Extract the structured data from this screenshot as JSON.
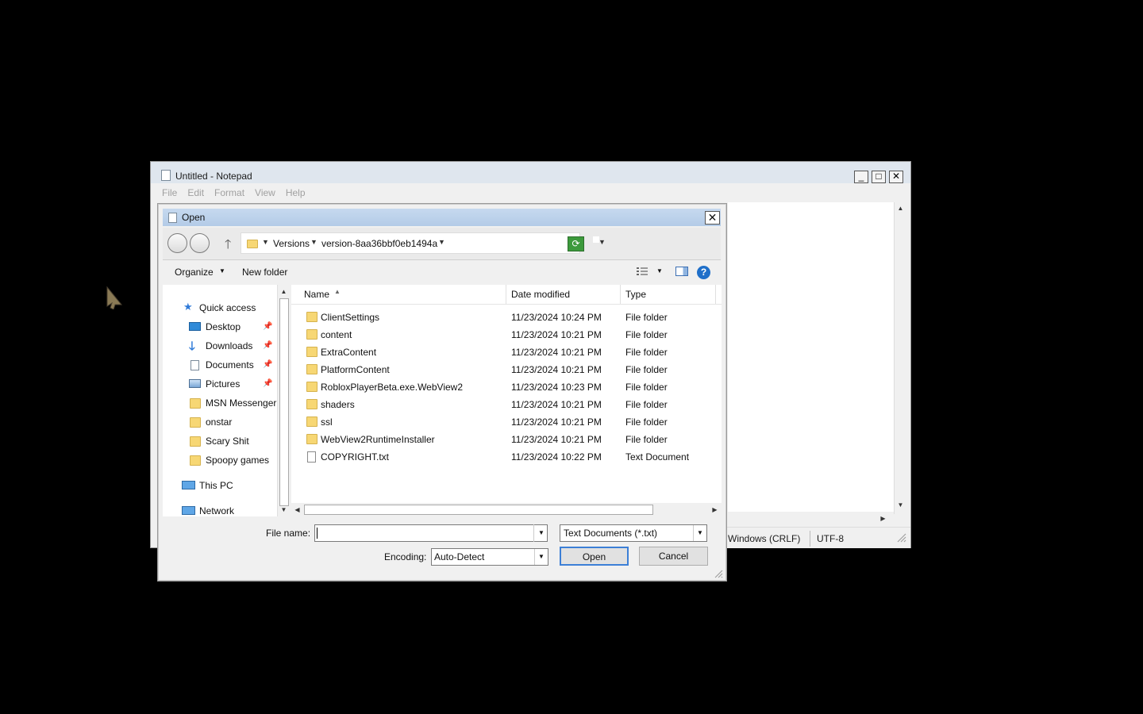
{
  "notepad": {
    "title": "Untitled - Notepad",
    "menu": [
      "File",
      "Edit",
      "Format",
      "View",
      "Help"
    ],
    "status": {
      "eol": "Windows (CRLF)",
      "encoding": "UTF-8"
    }
  },
  "dialog": {
    "title": "Open",
    "breadcrumb": [
      "Versions",
      "version-8aa36bbf0eb1494a"
    ],
    "toolbar": {
      "organize": "Organize",
      "new_folder": "New folder"
    },
    "nav": {
      "quick_access": "Quick access",
      "items": [
        {
          "label": "Desktop",
          "icon": "desktop-icon",
          "pinned": true
        },
        {
          "label": "Downloads",
          "icon": "downloads-icon",
          "pinned": true
        },
        {
          "label": "Documents",
          "icon": "documents-icon",
          "pinned": true
        },
        {
          "label": "Pictures",
          "icon": "pictures-icon",
          "pinned": true
        },
        {
          "label": "MSN Messenger",
          "icon": "folder-icon",
          "pinned": false
        },
        {
          "label": "onstar",
          "icon": "folder-icon",
          "pinned": false
        },
        {
          "label": "Scary Shit",
          "icon": "folder-icon",
          "pinned": false
        },
        {
          "label": "Spoopy games",
          "icon": "folder-icon",
          "pinned": false
        }
      ],
      "this_pc": "This PC",
      "network": "Network"
    },
    "columns": {
      "name": "Name",
      "date": "Date modified",
      "type": "Type"
    },
    "files": [
      {
        "name": "ClientSettings",
        "date": "11/23/2024 10:24 PM",
        "type": "File folder",
        "kind": "folder"
      },
      {
        "name": "content",
        "date": "11/23/2024 10:21 PM",
        "type": "File folder",
        "kind": "folder"
      },
      {
        "name": "ExtraContent",
        "date": "11/23/2024 10:21 PM",
        "type": "File folder",
        "kind": "folder"
      },
      {
        "name": "PlatformContent",
        "date": "11/23/2024 10:21 PM",
        "type": "File folder",
        "kind": "folder"
      },
      {
        "name": "RobloxPlayerBeta.exe.WebView2",
        "date": "11/23/2024 10:23 PM",
        "type": "File folder",
        "kind": "folder"
      },
      {
        "name": "shaders",
        "date": "11/23/2024 10:21 PM",
        "type": "File folder",
        "kind": "folder"
      },
      {
        "name": "ssl",
        "date": "11/23/2024 10:21 PM",
        "type": "File folder",
        "kind": "folder"
      },
      {
        "name": "WebView2RuntimeInstaller",
        "date": "11/23/2024 10:21 PM",
        "type": "File folder",
        "kind": "folder"
      },
      {
        "name": "COPYRIGHT.txt",
        "date": "11/23/2024 10:22 PM",
        "type": "Text Document",
        "kind": "text"
      }
    ],
    "file_name_label": "File name:",
    "file_name_value": "",
    "filter": "Text Documents (*.txt)",
    "encoding_label": "Encoding:",
    "encoding_value": "Auto-Detect",
    "open_label": "Open",
    "cancel_label": "Cancel"
  },
  "colors": {
    "folder": "#f7d774",
    "accent": "#3c7fd6",
    "title_bar": "#c6d9ef"
  }
}
